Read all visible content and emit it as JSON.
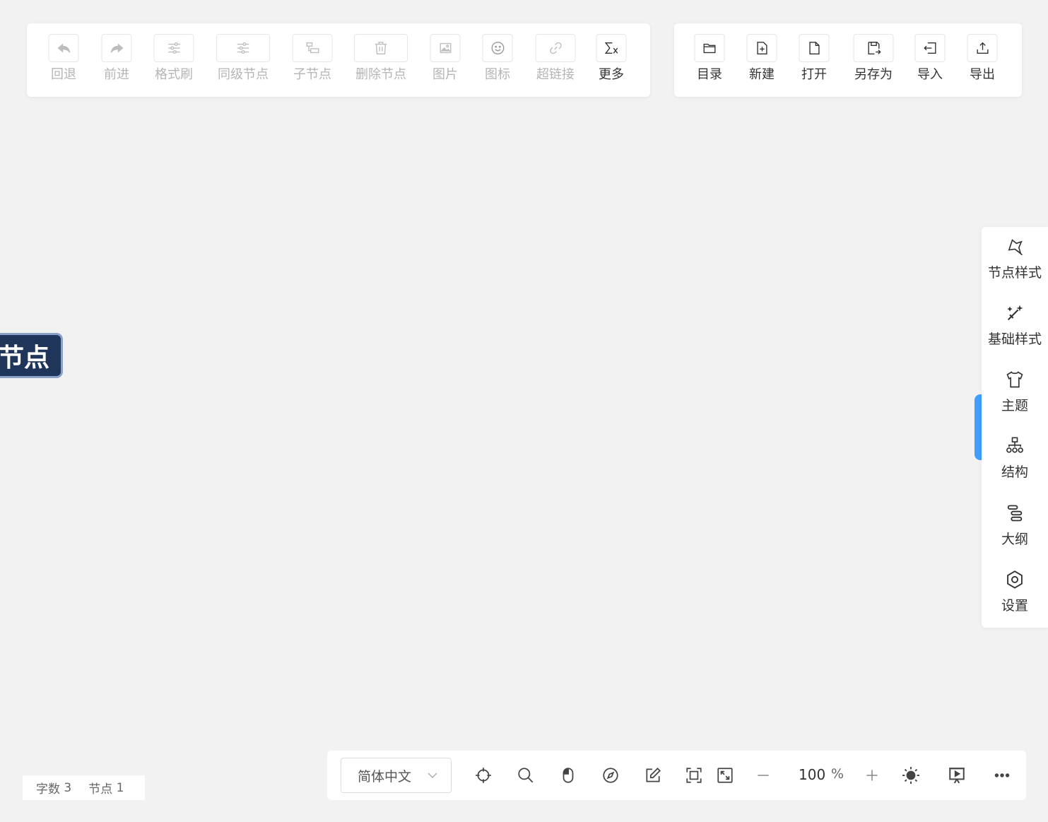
{
  "edit_toolbar": {
    "undo": "回退",
    "redo": "前进",
    "format_painter": "格式刷",
    "sibling_node": "同级节点",
    "child_node": "子节点",
    "delete_node": "删除节点",
    "image": "图片",
    "icon": "图标",
    "hyperlink": "超链接",
    "more": "更多"
  },
  "file_toolbar": {
    "directory": "目录",
    "new": "新建",
    "open": "打开",
    "save_as": "另存为",
    "import": "导入",
    "export": "导出"
  },
  "canvas": {
    "root_node_text": "节点"
  },
  "sidebar": {
    "items": [
      {
        "label": "节点样式",
        "icon": "node-style-icon"
      },
      {
        "label": "基础样式",
        "icon": "magic-wand-icon"
      },
      {
        "label": "主题",
        "icon": "shirt-icon"
      },
      {
        "label": "结构",
        "icon": "structure-icon"
      },
      {
        "label": "大纲",
        "icon": "outline-icon"
      },
      {
        "label": "设置",
        "icon": "settings-icon"
      }
    ],
    "accent_color": "#409eff"
  },
  "status": {
    "word_count_label": "字数",
    "word_count": "3",
    "node_count_label": "节点",
    "node_count": "1"
  },
  "bottom_toolbar": {
    "language": "简体中文",
    "zoom": "100",
    "zoom_unit": "%"
  },
  "colors": {
    "root_node_bg": "#1f3559",
    "root_node_border": "#8aa2c9",
    "canvas_bg": "#f2f2f2"
  }
}
